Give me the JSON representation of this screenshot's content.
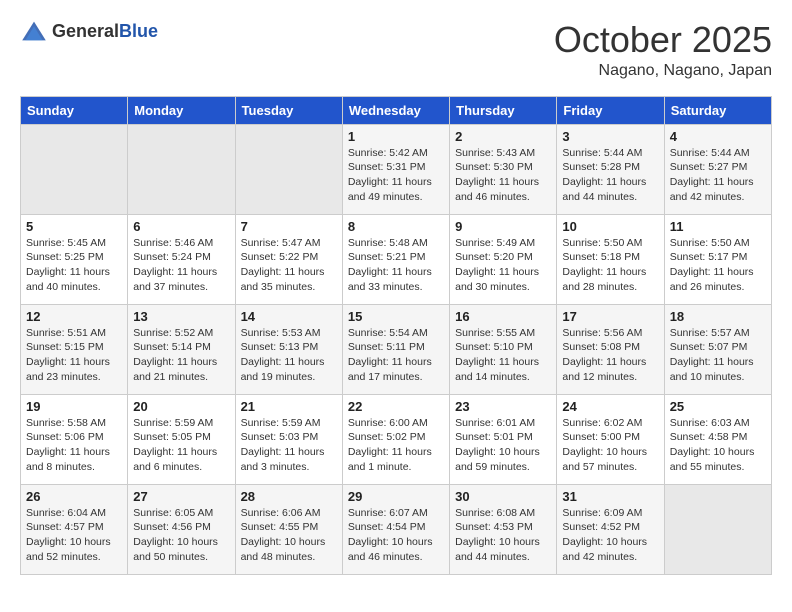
{
  "logo": {
    "general": "General",
    "blue": "Blue"
  },
  "header": {
    "title": "October 2025",
    "subtitle": "Nagano, Nagano, Japan"
  },
  "weekdays": [
    "Sunday",
    "Monday",
    "Tuesday",
    "Wednesday",
    "Thursday",
    "Friday",
    "Saturday"
  ],
  "weeks": [
    [
      null,
      null,
      null,
      {
        "day": "1",
        "sunrise": "Sunrise: 5:42 AM",
        "sunset": "Sunset: 5:31 PM",
        "daylight": "Daylight: 11 hours and 49 minutes."
      },
      {
        "day": "2",
        "sunrise": "Sunrise: 5:43 AM",
        "sunset": "Sunset: 5:30 PM",
        "daylight": "Daylight: 11 hours and 46 minutes."
      },
      {
        "day": "3",
        "sunrise": "Sunrise: 5:44 AM",
        "sunset": "Sunset: 5:28 PM",
        "daylight": "Daylight: 11 hours and 44 minutes."
      },
      {
        "day": "4",
        "sunrise": "Sunrise: 5:44 AM",
        "sunset": "Sunset: 5:27 PM",
        "daylight": "Daylight: 11 hours and 42 minutes."
      }
    ],
    [
      {
        "day": "5",
        "sunrise": "Sunrise: 5:45 AM",
        "sunset": "Sunset: 5:25 PM",
        "daylight": "Daylight: 11 hours and 40 minutes."
      },
      {
        "day": "6",
        "sunrise": "Sunrise: 5:46 AM",
        "sunset": "Sunset: 5:24 PM",
        "daylight": "Daylight: 11 hours and 37 minutes."
      },
      {
        "day": "7",
        "sunrise": "Sunrise: 5:47 AM",
        "sunset": "Sunset: 5:22 PM",
        "daylight": "Daylight: 11 hours and 35 minutes."
      },
      {
        "day": "8",
        "sunrise": "Sunrise: 5:48 AM",
        "sunset": "Sunset: 5:21 PM",
        "daylight": "Daylight: 11 hours and 33 minutes."
      },
      {
        "day": "9",
        "sunrise": "Sunrise: 5:49 AM",
        "sunset": "Sunset: 5:20 PM",
        "daylight": "Daylight: 11 hours and 30 minutes."
      },
      {
        "day": "10",
        "sunrise": "Sunrise: 5:50 AM",
        "sunset": "Sunset: 5:18 PM",
        "daylight": "Daylight: 11 hours and 28 minutes."
      },
      {
        "day": "11",
        "sunrise": "Sunrise: 5:50 AM",
        "sunset": "Sunset: 5:17 PM",
        "daylight": "Daylight: 11 hours and 26 minutes."
      }
    ],
    [
      {
        "day": "12",
        "sunrise": "Sunrise: 5:51 AM",
        "sunset": "Sunset: 5:15 PM",
        "daylight": "Daylight: 11 hours and 23 minutes."
      },
      {
        "day": "13",
        "sunrise": "Sunrise: 5:52 AM",
        "sunset": "Sunset: 5:14 PM",
        "daylight": "Daylight: 11 hours and 21 minutes."
      },
      {
        "day": "14",
        "sunrise": "Sunrise: 5:53 AM",
        "sunset": "Sunset: 5:13 PM",
        "daylight": "Daylight: 11 hours and 19 minutes."
      },
      {
        "day": "15",
        "sunrise": "Sunrise: 5:54 AM",
        "sunset": "Sunset: 5:11 PM",
        "daylight": "Daylight: 11 hours and 17 minutes."
      },
      {
        "day": "16",
        "sunrise": "Sunrise: 5:55 AM",
        "sunset": "Sunset: 5:10 PM",
        "daylight": "Daylight: 11 hours and 14 minutes."
      },
      {
        "day": "17",
        "sunrise": "Sunrise: 5:56 AM",
        "sunset": "Sunset: 5:08 PM",
        "daylight": "Daylight: 11 hours and 12 minutes."
      },
      {
        "day": "18",
        "sunrise": "Sunrise: 5:57 AM",
        "sunset": "Sunset: 5:07 PM",
        "daylight": "Daylight: 11 hours and 10 minutes."
      }
    ],
    [
      {
        "day": "19",
        "sunrise": "Sunrise: 5:58 AM",
        "sunset": "Sunset: 5:06 PM",
        "daylight": "Daylight: 11 hours and 8 minutes."
      },
      {
        "day": "20",
        "sunrise": "Sunrise: 5:59 AM",
        "sunset": "Sunset: 5:05 PM",
        "daylight": "Daylight: 11 hours and 6 minutes."
      },
      {
        "day": "21",
        "sunrise": "Sunrise: 5:59 AM",
        "sunset": "Sunset: 5:03 PM",
        "daylight": "Daylight: 11 hours and 3 minutes."
      },
      {
        "day": "22",
        "sunrise": "Sunrise: 6:00 AM",
        "sunset": "Sunset: 5:02 PM",
        "daylight": "Daylight: 11 hours and 1 minute."
      },
      {
        "day": "23",
        "sunrise": "Sunrise: 6:01 AM",
        "sunset": "Sunset: 5:01 PM",
        "daylight": "Daylight: 10 hours and 59 minutes."
      },
      {
        "day": "24",
        "sunrise": "Sunrise: 6:02 AM",
        "sunset": "Sunset: 5:00 PM",
        "daylight": "Daylight: 10 hours and 57 minutes."
      },
      {
        "day": "25",
        "sunrise": "Sunrise: 6:03 AM",
        "sunset": "Sunset: 4:58 PM",
        "daylight": "Daylight: 10 hours and 55 minutes."
      }
    ],
    [
      {
        "day": "26",
        "sunrise": "Sunrise: 6:04 AM",
        "sunset": "Sunset: 4:57 PM",
        "daylight": "Daylight: 10 hours and 52 minutes."
      },
      {
        "day": "27",
        "sunrise": "Sunrise: 6:05 AM",
        "sunset": "Sunset: 4:56 PM",
        "daylight": "Daylight: 10 hours and 50 minutes."
      },
      {
        "day": "28",
        "sunrise": "Sunrise: 6:06 AM",
        "sunset": "Sunset: 4:55 PM",
        "daylight": "Daylight: 10 hours and 48 minutes."
      },
      {
        "day": "29",
        "sunrise": "Sunrise: 6:07 AM",
        "sunset": "Sunset: 4:54 PM",
        "daylight": "Daylight: 10 hours and 46 minutes."
      },
      {
        "day": "30",
        "sunrise": "Sunrise: 6:08 AM",
        "sunset": "Sunset: 4:53 PM",
        "daylight": "Daylight: 10 hours and 44 minutes."
      },
      {
        "day": "31",
        "sunrise": "Sunrise: 6:09 AM",
        "sunset": "Sunset: 4:52 PM",
        "daylight": "Daylight: 10 hours and 42 minutes."
      },
      null
    ]
  ]
}
